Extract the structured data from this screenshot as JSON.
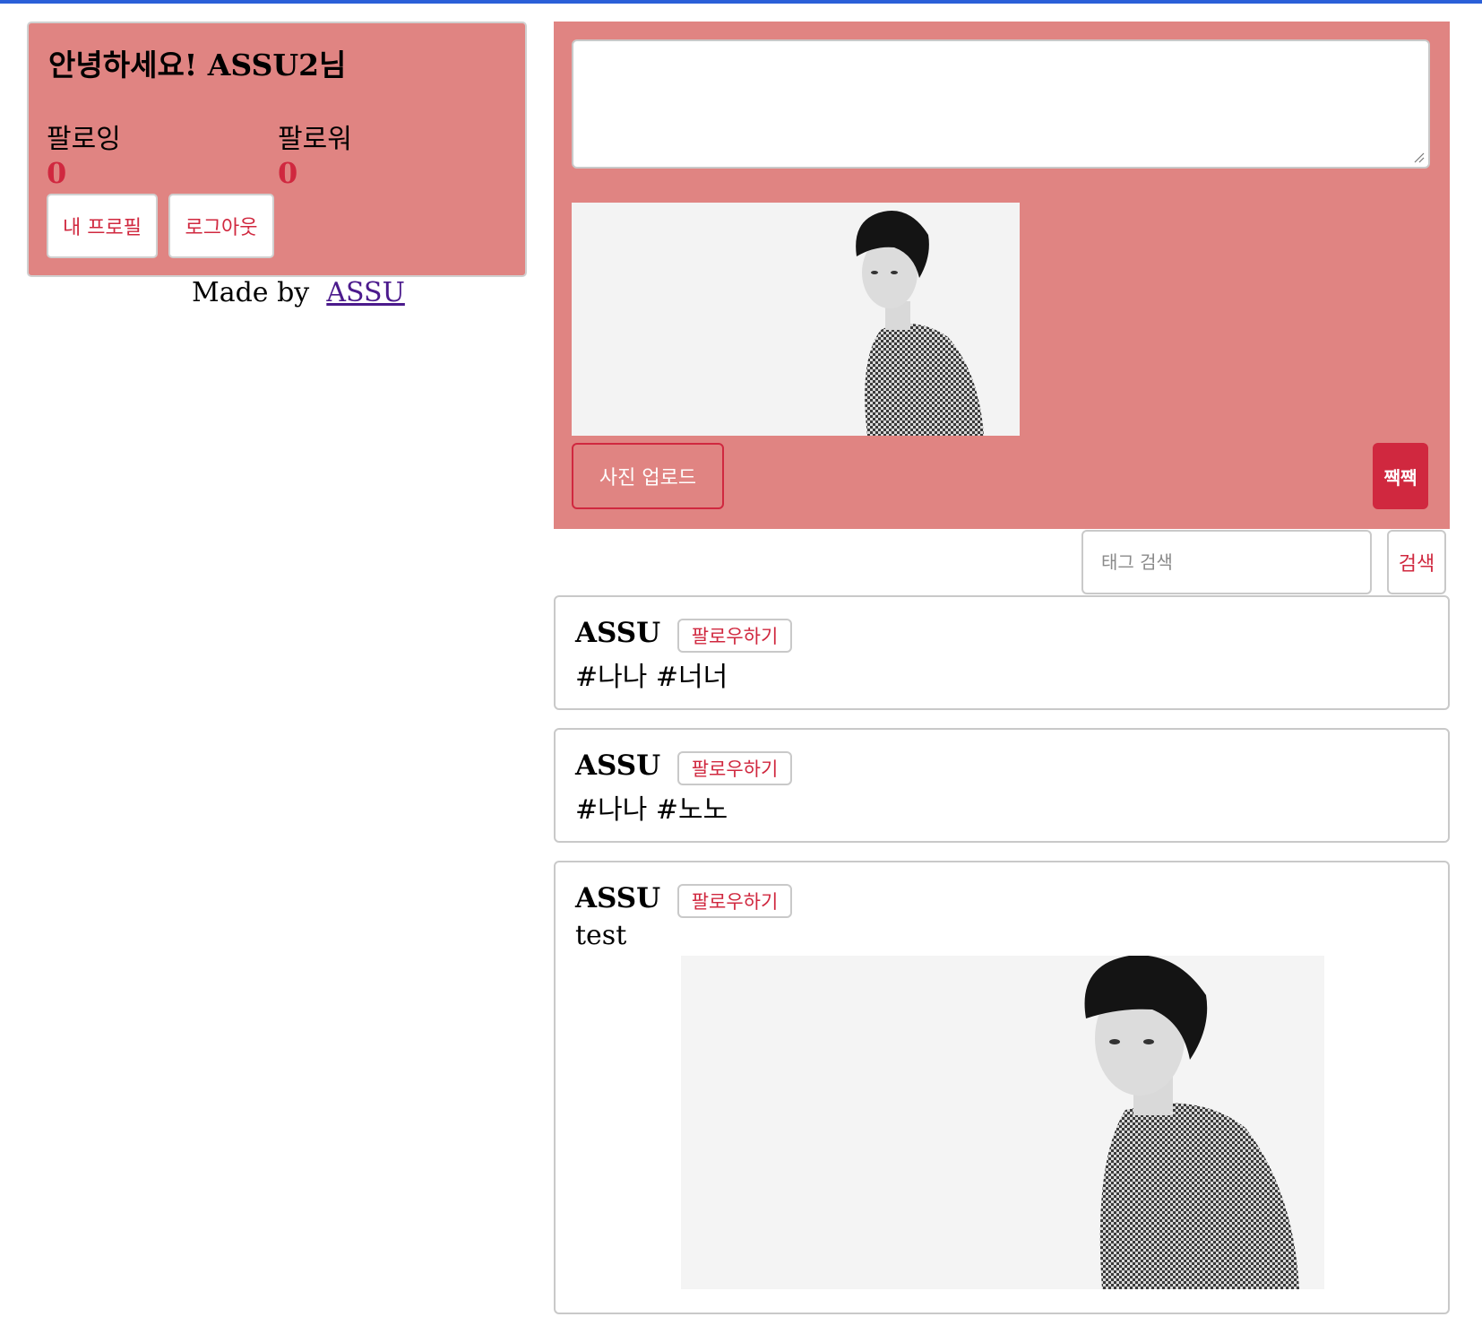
{
  "profile": {
    "greeting": "안녕하세요! ASSU2님",
    "following_label": "팔로잉",
    "following_count": "0",
    "follower_label": "팔로워",
    "follower_count": "0",
    "my_profile_label": "내 프로필",
    "logout_label": "로그아웃"
  },
  "footer": {
    "made_by_prefix": "Made by",
    "made_by_link": "ASSU"
  },
  "form": {
    "tweet_text": "",
    "upload_label": "사진 업로드",
    "submit_label": "짹짹"
  },
  "search": {
    "placeholder": "태그 검색",
    "button_label": "검색"
  },
  "tweets": [
    {
      "author": "ASSU",
      "follow_label": "팔로우하기",
      "content": "#나나 #너너"
    },
    {
      "author": "ASSU",
      "follow_label": "팔로우하기",
      "content": "#나나 #노노"
    },
    {
      "author": "ASSU",
      "follow_label": "팔로우하기",
      "content": "test"
    }
  ],
  "colors": {
    "accent": "#d0283f",
    "panel": "#e08482",
    "topbar": "#2a5fd8"
  }
}
